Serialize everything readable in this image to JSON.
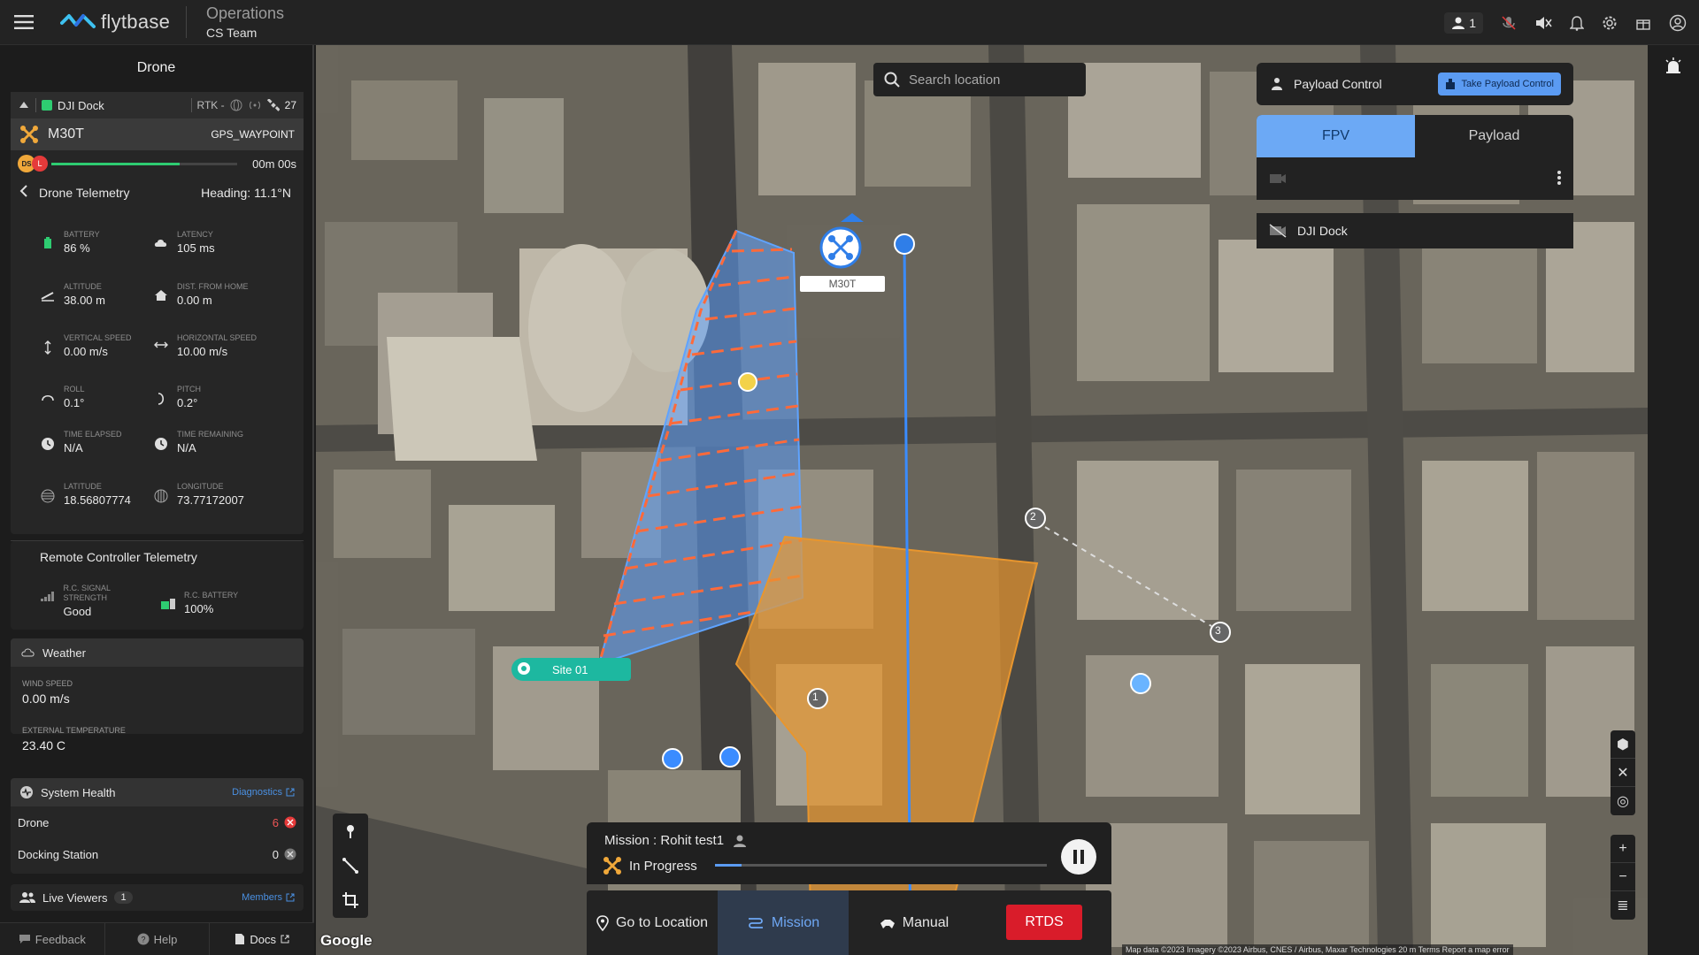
{
  "header": {
    "logo_text": "flytbase",
    "workspace_title": "Operations",
    "workspace_team": "CS Team",
    "viewer_count": "1"
  },
  "left_panel": {
    "title": "Drone",
    "dock": {
      "name": "DJI Dock",
      "rtk": "RTK -",
      "satellites": "27"
    },
    "drone": {
      "name": "M30T",
      "mode": "GPS_WAYPOINT"
    },
    "progress": {
      "ds_label": "DS",
      "l_label": "L",
      "time": "00m 00s",
      "fraction": 0.69
    },
    "telemetry": {
      "title": "Drone Telemetry",
      "heading": "Heading: 11.1°N",
      "battery_label": "Battery",
      "battery": "86 %",
      "latency_label": "Latency",
      "latency": "105 ms",
      "altitude_label": "Altitude",
      "altitude": "38.00 m",
      "dist_label": "Dist. From Home",
      "dist": "0.00 m",
      "vspeed_label": "Vertical Speed",
      "vspeed": "0.00 m/s",
      "hspeed_label": "Horizontal Speed",
      "hspeed": "10.00 m/s",
      "roll_label": "Roll",
      "roll": "0.1°",
      "pitch_label": "Pitch",
      "pitch": "0.2°",
      "elapsed_label": "Time Elapsed",
      "elapsed": "N/A",
      "remaining_label": "Time Remaining",
      "remaining": "N/A",
      "lat_label": "Latitude",
      "lat": "18.56807774",
      "lon_label": "Longitude",
      "lon": "73.77172007"
    },
    "rc": {
      "title": "Remote Controller Telemetry",
      "signal_label": "R.C. Signal Strength",
      "signal": "Good",
      "battery_label": "R.C. Battery",
      "battery": "100%"
    },
    "weather": {
      "title": "Weather",
      "wind_label": "Wind Speed",
      "wind": "0.00 m/s",
      "temp_label": "External Temperature",
      "temp": "23.40 C"
    },
    "health": {
      "title": "System Health",
      "link": "Diagnostics",
      "drone_label": "Drone",
      "drone_count": "6",
      "dock_label": "Docking Station",
      "dock_count": "0"
    },
    "viewers": {
      "title": "Live Viewers",
      "count": "1",
      "link": "Members"
    },
    "footer": {
      "feedback": "Feedback",
      "help": "Help",
      "docs": "Docs"
    }
  },
  "map": {
    "search_placeholder": "Search location",
    "drone_label": "M30T",
    "site_label": "Site 01",
    "waypoints": [
      "1",
      "2",
      "3"
    ],
    "google": "Google",
    "attribution": "Map data ©2023 Imagery ©2023 Airbus, CNES / Airbus, Maxar Technologies   20 m   Terms   Report a map error"
  },
  "payload": {
    "title": "Payload Control",
    "take_button": "Take Payload Control",
    "tab_fpv": "FPV",
    "tab_payload": "Payload",
    "feed_name": "DJI Dock"
  },
  "mission": {
    "title": "Mission : Rohit test1",
    "status": "In Progress",
    "progress": 0.08
  },
  "actions": {
    "goto": "Go to Location",
    "mission": "Mission",
    "manual": "Manual",
    "rtds": "RTDS"
  },
  "colors": {
    "accent_blue": "#5b9bf2",
    "survey_blue": "#5fa3ff",
    "survey_orange": "#e8962e",
    "rtds_red": "#d91c2a",
    "site_teal": "#1db8a0"
  }
}
